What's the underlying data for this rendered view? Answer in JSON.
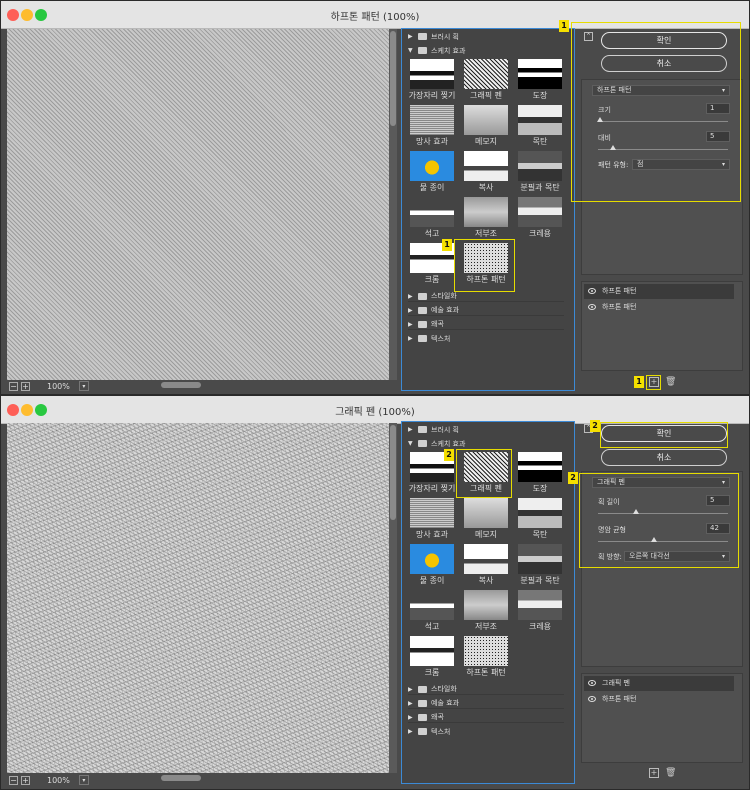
{
  "windows": [
    {
      "title": "하프톤 패턴 (100%)",
      "zoom": "100%",
      "gallery": {
        "categories_top": [
          "브러시 획",
          "스케치 효과"
        ],
        "filters": [
          "가장자리 찢기",
          "그래픽 펜",
          "도장",
          "망사 효과",
          "메모지",
          "목탄",
          "물 종이",
          "복사",
          "분필과 목탄",
          "석고",
          "저부조",
          "크레용",
          "크롬",
          "하프톤 패턴"
        ],
        "categories_bottom": [
          "스타일화",
          "예술 효과",
          "왜곡",
          "텍스처"
        ]
      },
      "buttons": {
        "ok": "확인",
        "cancel": "취소"
      },
      "settings": {
        "filter_select": "하프톤 패턴",
        "field1_label": "크기",
        "field1_value": "1",
        "field2_label": "대비",
        "field2_value": "5",
        "field3_label": "패턴 유형:",
        "field3_value": "점"
      },
      "layers": [
        "하프톤 패턴",
        "하프톤 패턴"
      ],
      "badges": [
        "1",
        "1",
        "1"
      ]
    },
    {
      "title": "그래픽 펜 (100%)",
      "zoom": "100%",
      "gallery": {
        "categories_top": [
          "브러시 획",
          "스케치 효과"
        ],
        "filters": [
          "가장자리 찢기",
          "그래픽 펜",
          "도장",
          "망사 효과",
          "메모지",
          "목탄",
          "물 종이",
          "복사",
          "분필과 목탄",
          "석고",
          "저부조",
          "크레용",
          "크롬",
          "하프톤 패턴"
        ],
        "categories_bottom": [
          "스타일화",
          "예술 효과",
          "왜곡",
          "텍스처"
        ]
      },
      "buttons": {
        "ok": "확인",
        "cancel": "취소"
      },
      "settings": {
        "filter_select": "그래픽 펜",
        "field1_label": "획 길이",
        "field1_value": "5",
        "field2_label": "명암 균형",
        "field2_value": "42",
        "field3_label": "획 방향:",
        "field3_value": "오른쪽 대각선"
      },
      "layers": [
        "그래픽 펜",
        "하프톤 패턴"
      ],
      "badges": [
        "2",
        "2",
        "2"
      ]
    }
  ],
  "colors": {
    "highlight": "#e6dc00",
    "badge": "#f5e000",
    "gallery_border": "#3c8ad6"
  }
}
